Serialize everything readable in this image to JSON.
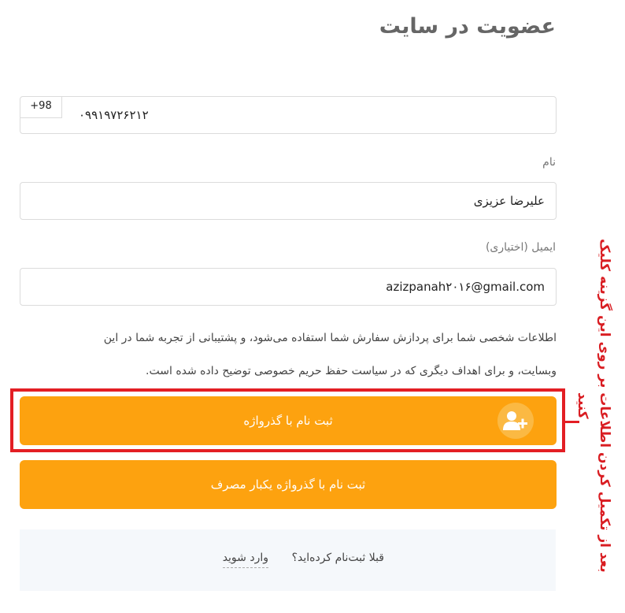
{
  "page": {
    "title": "عضویت در سایت"
  },
  "phone": {
    "prefix": "+98",
    "value": "۰۹۹۱۹۷۲۶۲۱۲"
  },
  "name": {
    "label": "نام",
    "value": "علیرضا عزیزی"
  },
  "email": {
    "label": "ایمیل (اختیاری)",
    "value": "azizpanah۲۰۱۶@gmail.com"
  },
  "info": {
    "line1": "اطلاعات شخصی شما برای پردازش سفارش شما استفاده می‌شود، و پشتیبانی از تجربه شما در این",
    "line2": "وبسایت، و برای اهداف دیگری که در سیاست حفظ حریم خصوصی توضیح داده شده است."
  },
  "buttons": {
    "password_register": "ثبت نام با گذرواژه",
    "otp_register": "ثبت نام با گذرواژه یکبار مصرف",
    "icon": "user-plus-icon"
  },
  "login": {
    "question": "قبلا ثبت‌نام کرده‌اید؟",
    "link": "وارد شوید"
  },
  "annotation": {
    "text": "بعد از تکمیل کردن اطلاعات بر روی این گزینه کلیک کنید"
  },
  "colors": {
    "button": "#fda20f",
    "highlight": "#e31e24",
    "annotation": "#d91d22"
  }
}
